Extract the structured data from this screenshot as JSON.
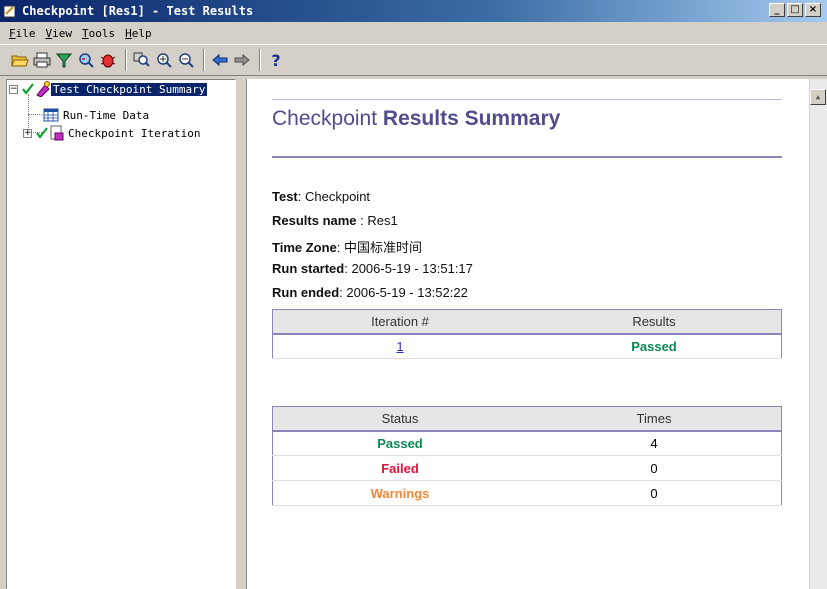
{
  "window": {
    "title": "Checkpoint [Res1] - Test Results",
    "minimize": "_",
    "maximize": "□",
    "close": "×"
  },
  "menu": [
    {
      "label": "File",
      "key": "F",
      "rest": "ile"
    },
    {
      "label": "View",
      "key": "V",
      "rest": "iew"
    },
    {
      "label": "Tools",
      "key": "T",
      "rest": "ools"
    },
    {
      "label": "Help",
      "key": "H",
      "rest": "elp"
    }
  ],
  "toolbar": {
    "icons": [
      "open-folder-icon",
      "print-icon",
      "filter-icon",
      "find-icon",
      "bug-icon",
      "zoom-fit-icon",
      "zoom-in-icon",
      "zoom-out-icon",
      "back-arrow-icon",
      "forward-arrow-icon",
      "help-icon"
    ],
    "help_label": "?"
  },
  "tree": {
    "root": "Test Checkpoint Summary",
    "child1": "Run-Time Data",
    "child2": "Checkpoint Iteration"
  },
  "report": {
    "title_plain": "Checkpoint",
    "title_bold": "Results Summary",
    "info": {
      "test_label": "Test",
      "test_value": "Checkpoint",
      "results_label": "Results name",
      "results_value": "Res1",
      "tz_label": "Time Zone",
      "tz_value": "中国标准时间",
      "started_label": "Run started",
      "started_value": "2006-5-19 - 13:51:17",
      "ended_label": "Run ended",
      "ended_value": "2006-5-19 - 13:52:22"
    },
    "iterations": {
      "col_iteration": "Iteration #",
      "col_results": "Results",
      "rows": [
        {
          "iteration": "1",
          "result": "Passed"
        }
      ]
    },
    "status": {
      "col_status": "Status",
      "col_times": "Times",
      "rows": [
        {
          "status": "Passed",
          "times": "4"
        },
        {
          "status": "Failed",
          "times": "0"
        },
        {
          "status": "Warnings",
          "times": "0"
        }
      ]
    }
  },
  "colors": {
    "passed": "#0b8a55",
    "failed": "#e01535",
    "warning": "#f0893a",
    "title": "#514c8c",
    "selection": "#0a246a"
  }
}
